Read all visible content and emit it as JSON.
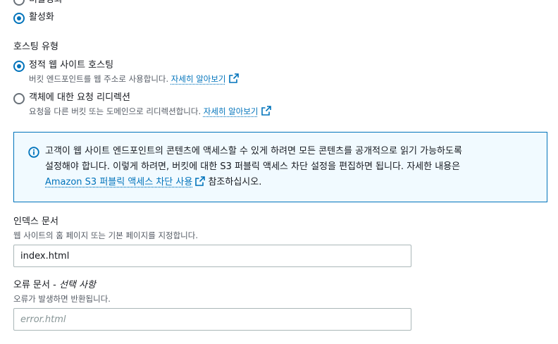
{
  "static_website": {
    "options": [
      {
        "label": "비활성화",
        "checked": false
      },
      {
        "label": "활성화",
        "checked": true
      }
    ]
  },
  "hosting_type": {
    "title": "호스팅 유형",
    "options": [
      {
        "label": "정적 웹 사이트 호스팅",
        "description": "버킷 엔드포인트를 웹 주소로 사용합니다.",
        "link": "자세히 알아보기",
        "checked": true
      },
      {
        "label": "객체에 대한 요청 리디렉션",
        "description": "요청을 다른 버킷 또는 도메인으로 리디렉션합니다.",
        "link": "자세히 알아보기",
        "checked": false
      }
    ]
  },
  "info": {
    "line1": "고객이 웹 사이트 엔드포인트의 콘텐츠에 액세스할 수 있게 하려면 모든 콘텐츠를 공개적으로 읽기 가능하도록",
    "line2": "설정해야 합니다. 이렇게 하려면, 버킷에 대한 S3 퍼블릭 액세스 차단 설정을 편집하면 됩니다. 자세한 내용은",
    "link": "Amazon S3 퍼블릭 액세스 차단 사용",
    "line3_suffix": "참조하십시오."
  },
  "index_document": {
    "label": "인덱스 문서",
    "description": "웹 사이트의 홈 페이지 또는 기본 페이지를 지정합니다.",
    "value": "index.html"
  },
  "error_document": {
    "label": "오류 문서 - ",
    "optional": "선택 사항",
    "description": "오류가 발생하면 반환됩니다.",
    "placeholder": "error.html"
  },
  "colors": {
    "accent": "#0073bb",
    "info_bg": "#f1faff",
    "text": "#16191f",
    "muted": "#545b64"
  }
}
